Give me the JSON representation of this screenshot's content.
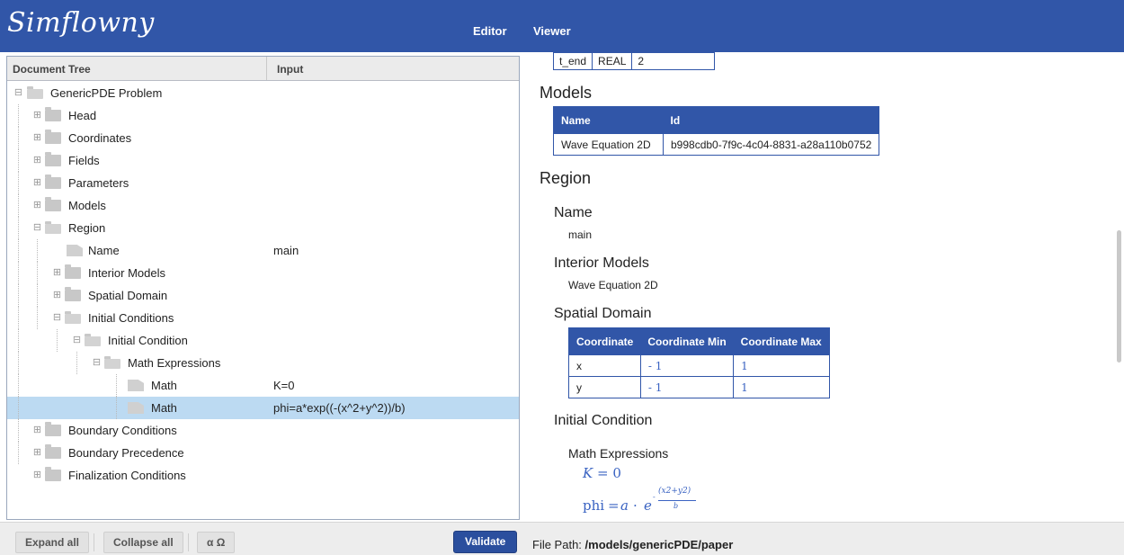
{
  "app": {
    "logo": "Simflowny"
  },
  "nav": {
    "editor": "Editor",
    "viewer": "Viewer"
  },
  "tree_header": {
    "document_tree": "Document Tree",
    "input": "Input"
  },
  "tree": [
    {
      "label": "GenericPDE Problem",
      "value": ""
    },
    {
      "label": "Head",
      "value": ""
    },
    {
      "label": "Coordinates",
      "value": ""
    },
    {
      "label": "Fields",
      "value": ""
    },
    {
      "label": "Parameters",
      "value": ""
    },
    {
      "label": "Models",
      "value": ""
    },
    {
      "label": "Region",
      "value": ""
    },
    {
      "label": "Name",
      "value": "main"
    },
    {
      "label": "Interior Models",
      "value": ""
    },
    {
      "label": "Spatial Domain",
      "value": ""
    },
    {
      "label": "Initial Conditions",
      "value": ""
    },
    {
      "label": "Initial Condition",
      "value": ""
    },
    {
      "label": "Math Expressions",
      "value": ""
    },
    {
      "label": "Math",
      "value": "K=0"
    },
    {
      "label": "Math",
      "value": "phi=a*exp((-(x^2+y^2))/b)"
    },
    {
      "label": "Boundary Conditions",
      "value": ""
    },
    {
      "label": "Boundary Precedence",
      "value": ""
    },
    {
      "label": "Finalization Conditions",
      "value": ""
    }
  ],
  "buttons": {
    "expand_all": "Expand all",
    "collapse_all": "Collapse all",
    "greek": "α Ω",
    "validate": "Validate"
  },
  "file_path": {
    "label": "File Path:",
    "value": "/models/genericPDE/paper"
  },
  "viewer": {
    "params_row": {
      "name": "t_end",
      "type": "REAL",
      "value": "2"
    },
    "models_heading": "Models",
    "models_table": {
      "headers": [
        "Name",
        "Id"
      ],
      "rows": [
        [
          "Wave Equation 2D",
          "b998cdb0-7f9c-4c04-8831-a28a110b0752"
        ]
      ]
    },
    "region_heading": "Region",
    "name_heading": "Name",
    "name_value": "main",
    "interior_heading": "Interior Models",
    "interior_value": "Wave Equation 2D",
    "spatial_heading": "Spatial Domain",
    "domain_table": {
      "headers": [
        "Coordinate",
        "Coordinate Min",
        "Coordinate Max"
      ],
      "rows": [
        [
          "x",
          "- 1",
          "1"
        ],
        [
          "y",
          "- 1",
          "1"
        ]
      ]
    },
    "initial_heading": "Initial Condition",
    "math_heading": "Math Expressions",
    "math": {
      "k_lhs": "K",
      "k_eq": "= 0",
      "phi_lhs": "phi",
      "phi_eq": "=",
      "a": "a",
      "dot": "·",
      "e": "e",
      "exp_num": "(x2+y2)",
      "exp_minus": "-",
      "exp_den": "b"
    }
  }
}
